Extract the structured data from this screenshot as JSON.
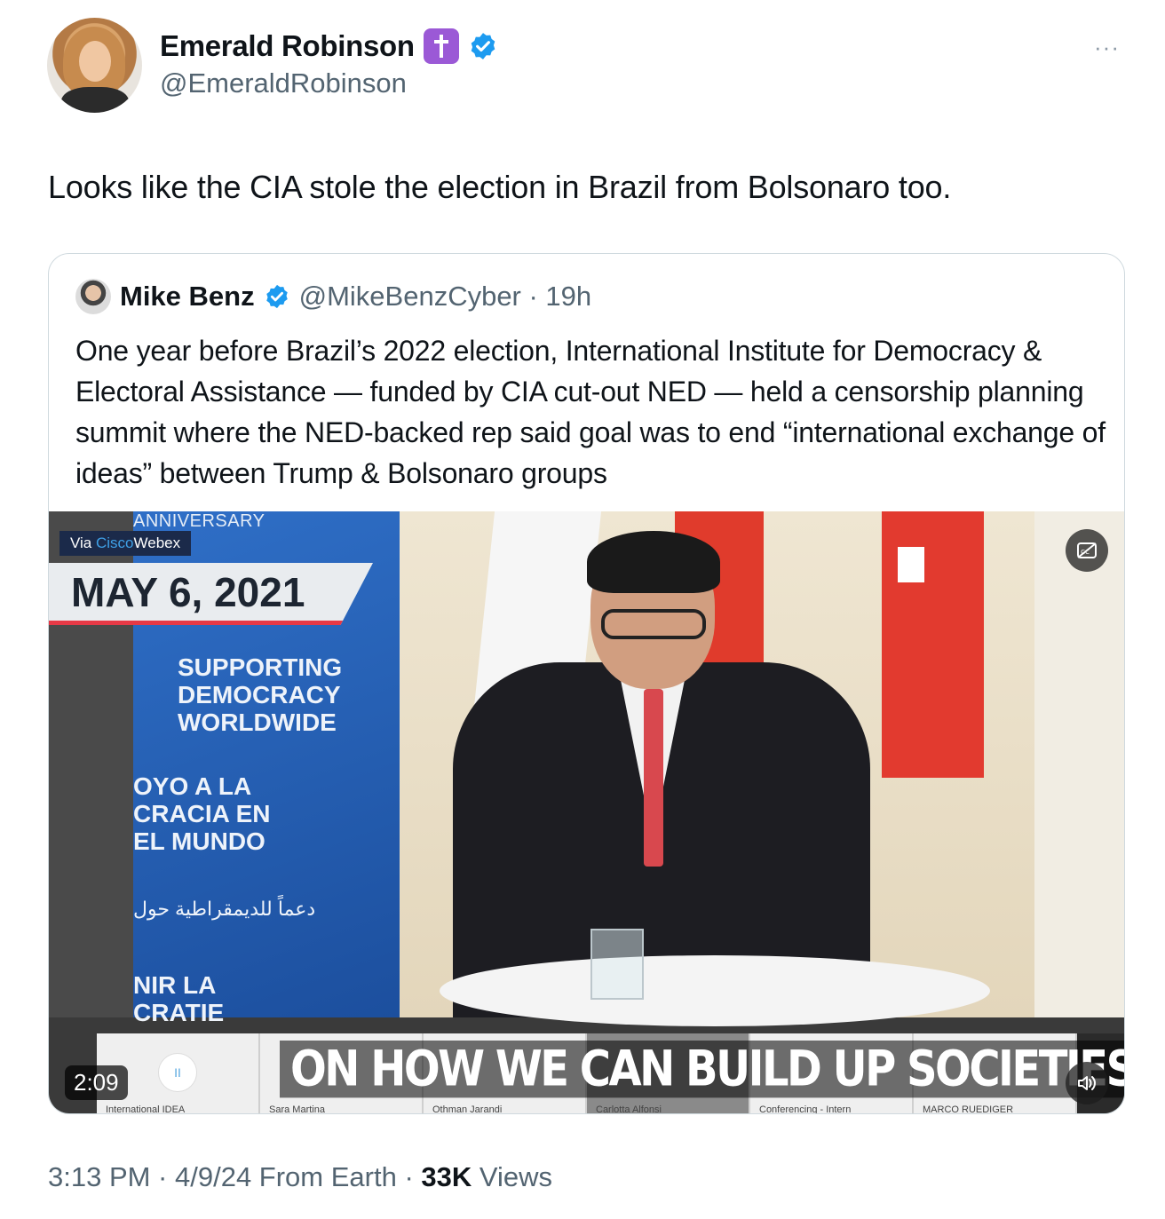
{
  "author": {
    "name": "Emerald Robinson",
    "handle": "@EmeraldRobinson",
    "badge_icon": "latin-cross-emoji",
    "verified_color": "#1d9bf0"
  },
  "more_label": "···",
  "tweet": {
    "text": "Looks like the CIA stole the election in Brazil from Bolsonaro too."
  },
  "quote": {
    "name": "Mike Benz",
    "handle_time": "@MikeBenzCyber · 19h",
    "text": "One year before Brazil’s 2022 election, International Institute for Democracy & Electoral Assistance — funded by CIA cut-out NED — held a censorship planning summit where the NED-backed rep said goal was to end “international exchange of ideas” between Trump & Bolsonaro groups"
  },
  "video": {
    "via_prefix": "Via ",
    "via_cisco": "Cisco",
    "via_webex": "Webex",
    "anniversary": "ANNIVERSARY",
    "date": "MAY 6, 2021",
    "banner_en": [
      "SUPPORTING",
      "DEMOCRACY",
      "WORLDWIDE"
    ],
    "banner_es": [
      "OYO A LA",
      "CRACIA EN",
      "EL MUNDO"
    ],
    "banner_ar": "دعماً للديمقراطية حول",
    "banner_fr": [
      "NIR LA",
      "CRATIE"
    ],
    "caption": "ON HOW WE CAN BUILD UP SOCIETIES",
    "duration": "2:09",
    "pause_symbol": "II",
    "participants": [
      "International IDEA",
      "Sara Martina",
      "Othman Jarandi",
      "Carlotta Alfonsi",
      "Conferencing - Intern",
      "MARCO RUEDIGER"
    ]
  },
  "meta": {
    "time_date": "3:13 PM · 4/9/24 From Earth · ",
    "views_count": "33K",
    "views_label": " Views"
  }
}
